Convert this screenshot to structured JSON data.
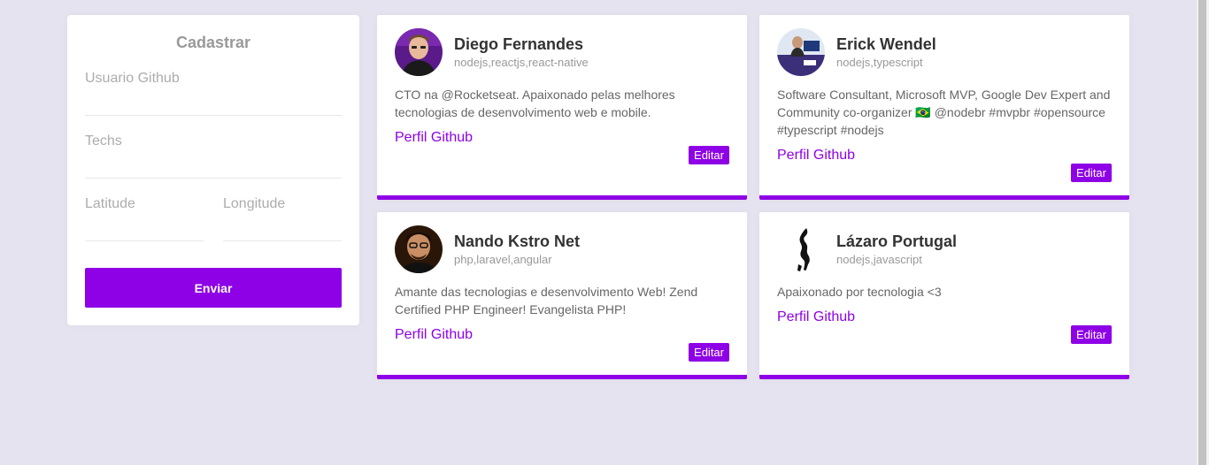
{
  "form": {
    "title": "Cadastrar",
    "github_user_label": "Usuario Github",
    "techs_label": "Techs",
    "latitude_label": "Latitude",
    "longitude_label": "Longitude",
    "submit_label": "Enviar"
  },
  "accent_color": "#8e00e6",
  "devs": [
    {
      "name": "Diego Fernandes",
      "techs": "nodejs,reactjs,react-native",
      "bio": "CTO na @Rocketseat. Apaixonado pelas melhores tecnologias de desenvolvimento web e mobile.",
      "link_label": "Perfil Github",
      "edit_label": "Editar",
      "avatar_icon": "avatar-photo-icon"
    },
    {
      "name": "Erick Wendel",
      "techs": "nodejs,typescript",
      "bio": "Software Consultant, Microsoft MVP, Google Dev Expert and Community co-organizer 🇧🇷 @nodebr #mvpbr #opensource #typescript #nodejs",
      "link_label": "Perfil Github",
      "edit_label": "Editar",
      "avatar_icon": "avatar-photo-icon"
    },
    {
      "name": "Nando Kstro Net",
      "techs": "php,laravel,angular",
      "bio": "Amante das tecnologias e desenvolvimento Web! Zend Certified PHP Engineer! Evangelista PHP!",
      "link_label": "Perfil Github",
      "edit_label": "Editar",
      "avatar_icon": "avatar-photo-icon"
    },
    {
      "name": "Lázaro Portugal",
      "techs": "nodejs,javascript",
      "bio": "Apaixonado por tecnologia <3",
      "link_label": "Perfil Github",
      "edit_label": "Editar",
      "avatar_icon": "avatar-photo-icon"
    }
  ]
}
